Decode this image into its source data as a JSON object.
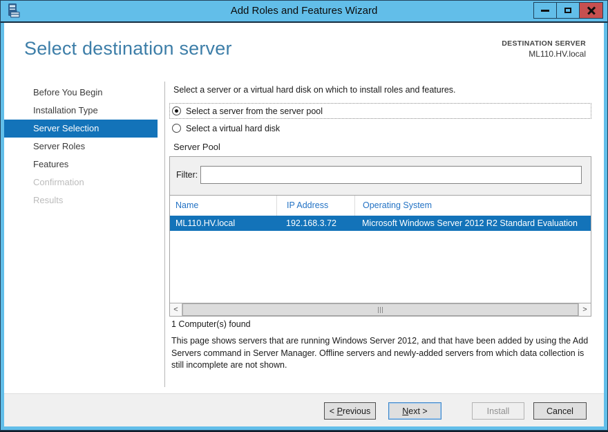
{
  "window": {
    "title": "Add Roles and Features Wizard",
    "icon": "server-manager",
    "controls": {
      "minimize": "minimize-icon",
      "maximize": "maximize-icon",
      "close": "close-icon"
    }
  },
  "header": {
    "title": "Select destination server",
    "destination_label": "DESTINATION SERVER",
    "destination_value": "ML110.HV.local"
  },
  "sidebar": {
    "items": [
      {
        "label": "Before You Begin",
        "state": "normal"
      },
      {
        "label": "Installation Type",
        "state": "normal"
      },
      {
        "label": "Server Selection",
        "state": "selected"
      },
      {
        "label": "Server Roles",
        "state": "normal"
      },
      {
        "label": "Features",
        "state": "normal"
      },
      {
        "label": "Confirmation",
        "state": "disabled"
      },
      {
        "label": "Results",
        "state": "disabled"
      }
    ]
  },
  "content": {
    "intro": "Select a server or a virtual hard disk on which to install roles and features.",
    "radios": [
      {
        "label": "Select a server from the server pool",
        "selected": true
      },
      {
        "label": "Select a virtual hard disk",
        "selected": false
      }
    ],
    "server_pool": {
      "section_label": "Server Pool",
      "filter_label": "Filter:",
      "filter_value": "",
      "table": {
        "columns": [
          "Name",
          "IP Address",
          "Operating System"
        ],
        "rows": [
          {
            "name": "ML110.HV.local",
            "ip": "192.168.3.72",
            "os": "Microsoft Windows Server 2012 R2 Standard Evaluation",
            "selected": true
          }
        ]
      },
      "scrollbar": {
        "left_arrow": "<",
        "right_arrow": ">"
      },
      "status": "1 Computer(s) found"
    },
    "description": "This page shows servers that are running Windows Server 2012, and that have been added by using the Add Servers command in Server Manager. Offline servers and newly-added servers from which data collection is still incomplete are not shown."
  },
  "footer": {
    "previous": {
      "prefix": "< ",
      "mnemonic": "P",
      "suffix": "revious"
    },
    "next": {
      "prefix": "",
      "mnemonic": "N",
      "suffix": "ext >"
    },
    "install": {
      "label": "Install"
    },
    "cancel": {
      "label": "Cancel"
    }
  },
  "colors": {
    "titlebar": "#62bee9",
    "close_button": "#c75050",
    "selection_blue": "#1373b9",
    "heading_text": "#3d7ea8",
    "table_header_text": "#2272c4",
    "footer_bg": "#f0f0f0"
  }
}
